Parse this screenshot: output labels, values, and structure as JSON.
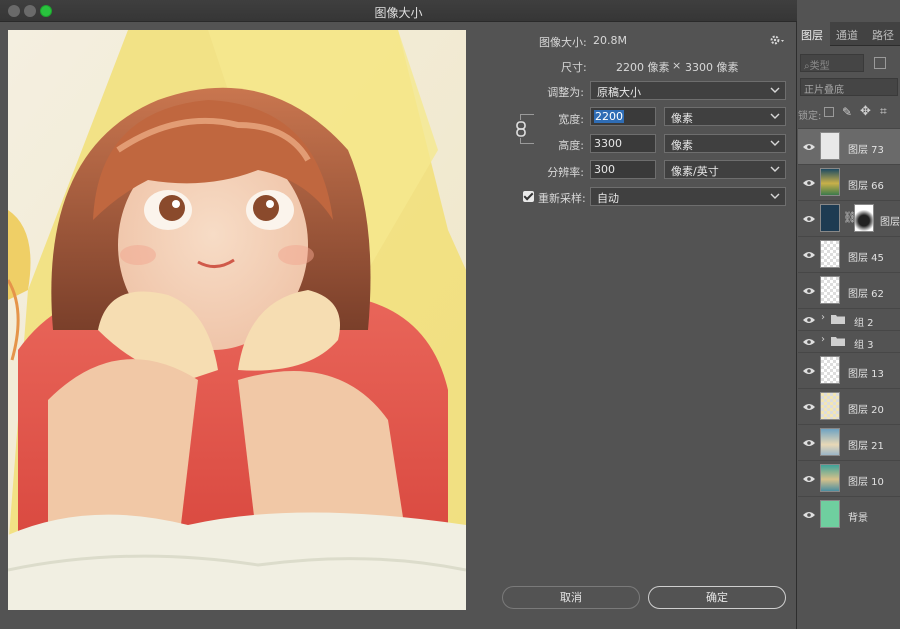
{
  "window": {
    "title": "图像大小"
  },
  "info": {
    "size_label": "图像大小:",
    "size_value": "20.8M",
    "dims_label": "尺寸:",
    "dims_w": "2200 像素",
    "dims_x": "×",
    "dims_h": "3300 像素"
  },
  "form": {
    "fit_label": "调整为:",
    "fit_value": "原稿大小",
    "width_label": "宽度:",
    "width_value": "2200",
    "width_unit": "像素",
    "height_label": "高度:",
    "height_value": "3300",
    "height_unit": "像素",
    "res_label": "分辨率:",
    "res_value": "300",
    "res_unit": "像素/英寸",
    "resample_label": "重新采样:",
    "resample_checked": true,
    "resample_value": "自动"
  },
  "buttons": {
    "cancel": "取消",
    "ok": "确定"
  },
  "panel": {
    "tabs": [
      "图层",
      "通道",
      "路径"
    ],
    "filter_placeholder": "类型",
    "blend_mode": "正片叠底",
    "lock_label": "锁定:",
    "layers": [
      {
        "name": "图层 73",
        "selected": true,
        "thumb": "blank"
      },
      {
        "name": "图层 66",
        "thumb": "art-green"
      },
      {
        "name": "图层",
        "thumb": "mask"
      },
      {
        "name": "图层 45",
        "thumb": "transparent-blue"
      },
      {
        "name": "图层 62",
        "thumb": "transparent-red"
      },
      {
        "name": "组 2",
        "type": "group"
      },
      {
        "name": "组 3",
        "type": "group"
      },
      {
        "name": "图层 13",
        "thumb": "transparent"
      },
      {
        "name": "图层 20",
        "thumb": "transparent-yellow"
      },
      {
        "name": "图层 21",
        "thumb": "art-blue"
      },
      {
        "name": "图层 10",
        "thumb": "art-teal"
      },
      {
        "name": "背景",
        "thumb": "green"
      }
    ]
  },
  "colors": {
    "accent_selection": "#2f6db5",
    "traffic_green": "#29c23e",
    "background_layer": "#6fcf9f"
  }
}
